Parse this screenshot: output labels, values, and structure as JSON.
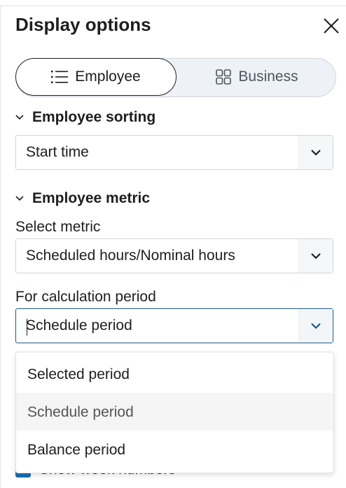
{
  "panel": {
    "title": "Display options"
  },
  "view_toggle": {
    "employee_label": "Employee",
    "business_label": "Business",
    "active": "Employee"
  },
  "employee_sorting": {
    "heading": "Employee sorting",
    "value": "Start time"
  },
  "employee_metric": {
    "heading": "Employee metric",
    "select_metric_label": "Select metric",
    "metric_value": "Scheduled hours/Nominal hours",
    "calc_period_label": "For calculation period",
    "calc_period_value": "Schedule period"
  },
  "calc_period_options": [
    "Selected period",
    "Schedule period",
    "Balance period"
  ],
  "selected_option_index": 1,
  "show_week_numbers": {
    "label": "Show week numbers",
    "checked": true
  },
  "colors": {
    "accent": "#1a6fb5",
    "focus_border": "#1c5a8a",
    "toggle_bg": "#eef1f5"
  }
}
